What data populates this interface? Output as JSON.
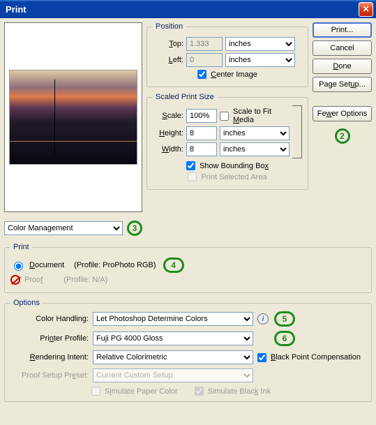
{
  "window": {
    "title": "Print"
  },
  "buttons": {
    "print": "Print...",
    "cancel": "Cancel",
    "done": "Done",
    "page_setup": "Page Setup...",
    "fewer_options": "Fewer Options"
  },
  "position": {
    "legend": "Position",
    "top_label": "Top:",
    "top_value": "1.333",
    "top_unit": "inches",
    "left_label": "Left:",
    "left_value": "0",
    "left_unit": "inches",
    "center_label": "Center Image",
    "center_checked": true
  },
  "scaled": {
    "legend": "Scaled Print Size",
    "scale_label": "Scale:",
    "scale_value": "100%",
    "fit_label": "Scale to Fit Media",
    "fit_checked": false,
    "height_label": "Height:",
    "height_value": "8",
    "height_unit": "inches",
    "width_label": "Width:",
    "width_value": "8",
    "width_unit": "inches",
    "bbox_label": "Show Bounding Box",
    "bbox_checked": true,
    "selarea_label": "Print Selected Area",
    "selarea_checked": false
  },
  "mode": {
    "selected": "Color Management"
  },
  "print_section": {
    "legend": "Print",
    "document_label": "Document",
    "document_profile": "(Profile: ProPhoto RGB)",
    "document_selected": true,
    "proof_label": "Proof",
    "proof_profile": "(Profile: N/A)",
    "proof_selected": false
  },
  "options": {
    "legend": "Options",
    "color_handling_label": "Color Handling:",
    "color_handling_value": "Let Photoshop Determine Colors",
    "printer_profile_label": "Printer Profile:",
    "printer_profile_value": "Fuji PG 4000 Gloss",
    "rendering_intent_label": "Rendering Intent:",
    "rendering_intent_value": "Relative Colorimetric",
    "bpc_label": "Black Point Compensation",
    "bpc_checked": true,
    "proof_preset_label": "Proof Setup Preset:",
    "proof_preset_value": "Current Custom Setup",
    "sim_paper_label": "Simulate Paper Color",
    "sim_paper_checked": false,
    "sim_ink_label": "Simulate Black Ink",
    "sim_ink_checked": true
  },
  "annotations": {
    "n2": "2",
    "n3": "3",
    "n4": "4",
    "n5": "5",
    "n6": "6"
  }
}
